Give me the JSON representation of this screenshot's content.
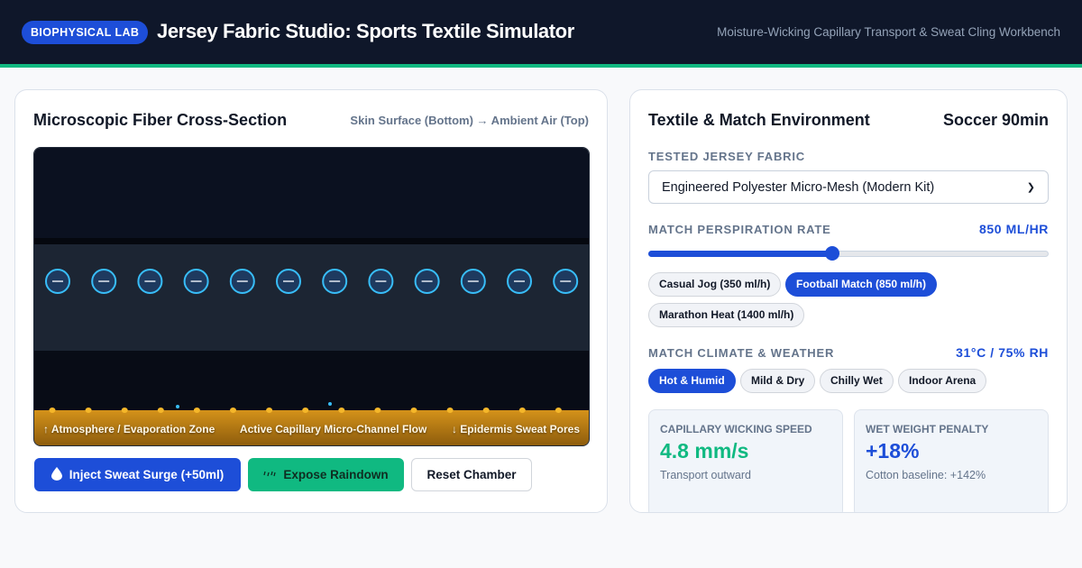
{
  "header": {
    "badge": "BIOPHYSICAL LAB",
    "title": "Jersey Fabric Studio: Sports Textile Simulator",
    "subtitle": "Moisture-Wicking Capillary Transport & Sweat Cling Workbench"
  },
  "cross_section": {
    "title": "Microscopic Fiber Cross-Section",
    "orientation": "Skin Surface (Bottom) → Ambient Air (Top)",
    "labels": {
      "top_zone": "↑ Atmosphere / Evaporation Zone",
      "middle_zone": "Active Capillary Micro-Channel Flow",
      "bottom_zone": "↓ Epidermis Sweat Pores"
    },
    "colors": {
      "air": "#0b1120",
      "fabric_band": "#1c2533",
      "fiber_stroke": "#38bdf8",
      "skin": "#c88a17"
    },
    "actions": {
      "inject": "Inject Sweat Surge (+50ml)",
      "rain": "Expose Raindown",
      "reset": "Reset Chamber"
    }
  },
  "environment": {
    "title": "Textile & Match Environment",
    "match": "Soccer 90min",
    "fabric_label": "TESTED JERSEY FABRIC",
    "fabric_selected": "Engineered Polyester Micro-Mesh (Modern Kit)",
    "perspiration_label": "MATCH PERSPIRATION RATE",
    "perspiration_value": "850 ML/HR",
    "perspiration_level": 0.46,
    "presets": [
      {
        "label": "Casual Jog (350 ml/h)",
        "active": false
      },
      {
        "label": "Football Match (850 ml/h)",
        "active": true
      },
      {
        "label": "Marathon Heat (1400 ml/h)",
        "active": false
      }
    ],
    "climate_label": "MATCH CLIMATE & WEATHER",
    "climate_value": "31°C / 75% RH",
    "climates": [
      {
        "label": "Hot & Humid",
        "active": true
      },
      {
        "label": "Mild & Dry",
        "active": false
      },
      {
        "label": "Chilly Wet",
        "active": false
      },
      {
        "label": "Indoor Arena",
        "active": false
      }
    ],
    "stats": [
      {
        "label": "CAPILLARY WICKING SPEED",
        "value": "4.8 mm/s",
        "sub": "Transport outward",
        "color": "#10b981"
      },
      {
        "label": "WET WEIGHT PENALTY",
        "value": "+18%",
        "sub": "Cotton baseline: +142%",
        "color": "#1d4ed8"
      }
    ],
    "colors": {
      "accent": "#1d4ed8",
      "success": "#10b981"
    }
  }
}
